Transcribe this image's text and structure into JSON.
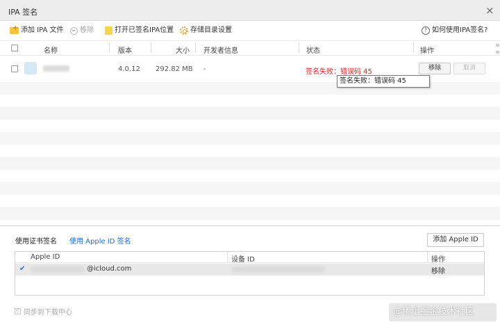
{
  "window": {
    "title": "IPA 签名",
    "close_glyph": "×"
  },
  "toolbar": {
    "add_ipa": "添加 IPA 文件",
    "remove": "移除",
    "open_signed_location": "打开已签名IPA位置",
    "storage_settings": "存储目录设置",
    "help": "如何使用IPA签名?"
  },
  "table": {
    "headers": {
      "name": "名称",
      "version": "版本",
      "size": "大小",
      "developer": "开发者信息",
      "status": "状态",
      "actions": "操作"
    },
    "rows": [
      {
        "name": "",
        "version": "4.0.12",
        "size": "292.82 MB",
        "developer": "-",
        "status": "签名失败：错误码 45",
        "remove": "移除",
        "cancel": "取消"
      }
    ]
  },
  "tooltip": "签名失败：错误码 45",
  "signing": {
    "tabs": [
      "使用证书签名",
      "使用 Apple ID 签名"
    ],
    "add_apple_id": "添加 Apple ID",
    "headers": {
      "apple_id": "Apple ID",
      "device_id": "设备 ID",
      "actions": "操作"
    },
    "accounts": [
      {
        "apple_id_suffix": "@icloud.com",
        "device_id": "",
        "action": "移除",
        "selected_glyph": "✔"
      }
    ],
    "sync_label": "同步到下载中心"
  },
  "watermark": "@稀土掘金技术社区",
  "colors": {
    "error": "#e02020",
    "link": "#1a6fd6"
  }
}
